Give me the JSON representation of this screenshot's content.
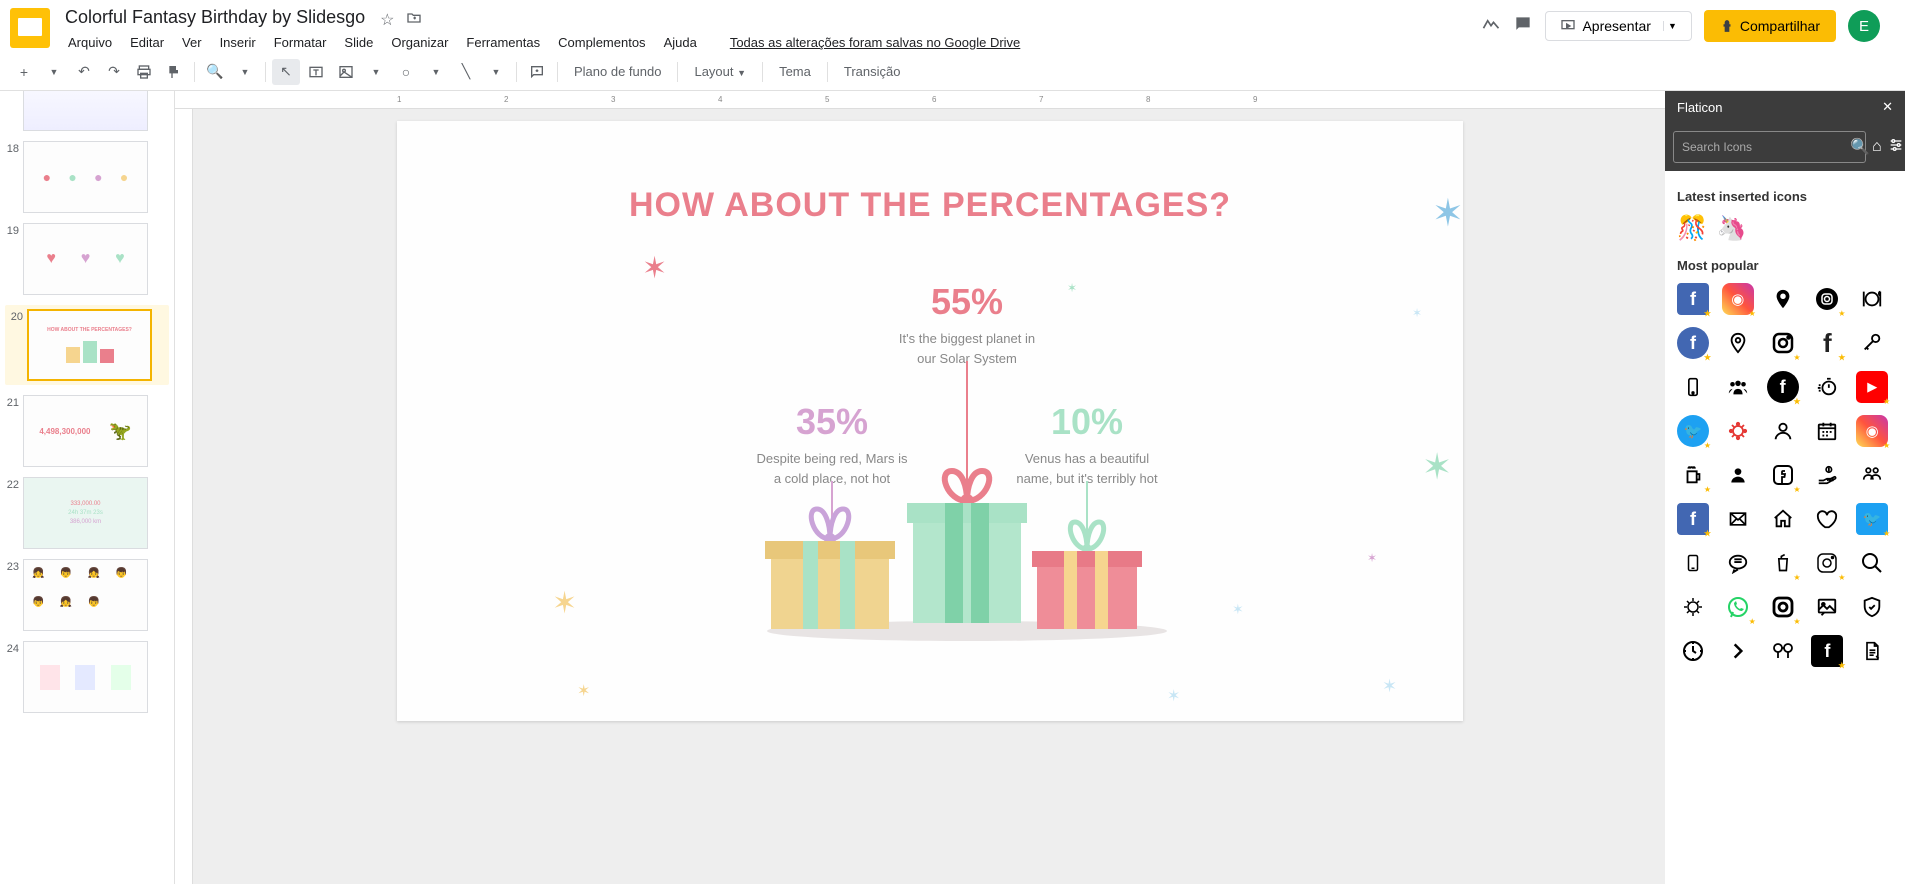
{
  "header": {
    "title": "Colorful Fantasy Birthday by Slidesgo",
    "menus": [
      "Arquivo",
      "Editar",
      "Ver",
      "Inserir",
      "Formatar",
      "Slide",
      "Organizar",
      "Ferramentas",
      "Complementos",
      "Ajuda"
    ],
    "drive_status": "Todas as alterações foram salvas no Google Drive",
    "present_label": "Apresentar",
    "share_label": "Compartilhar",
    "avatar_letter": "E"
  },
  "toolbar": {
    "plano": "Plano de fundo",
    "layout": "Layout",
    "tema": "Tema",
    "transicao": "Transição"
  },
  "filmstrip": {
    "numbers": [
      "18",
      "19",
      "20",
      "21",
      "22",
      "23",
      "24"
    ]
  },
  "slide": {
    "title": "HOW ABOUT THE PERCENTAGES?",
    "stats": {
      "left_pct": "35%",
      "left_desc1": "Despite being red, Mars is",
      "left_desc2": "a cold place, not hot",
      "center_pct": "55%",
      "center_desc1": "It's the biggest planet in",
      "center_desc2": "our Solar System",
      "right_pct": "10%",
      "right_desc1": "Venus has a beautiful",
      "right_desc2": "name, but it's terribly hot"
    }
  },
  "ruler": {
    "marks": [
      "1",
      "2",
      "3",
      "4",
      "5",
      "6",
      "7",
      "8",
      "9"
    ]
  },
  "thumbs": {
    "t21_num": "4,498,300,000",
    "t22_a": "333,000.00",
    "t22_b": "24h 37m 23s",
    "t22_c": "386,000 km"
  },
  "flaticon": {
    "title": "Flaticon",
    "search_placeholder": "Search Icons",
    "recent_title": "Latest inserted icons",
    "popular_title": "Most popular"
  }
}
